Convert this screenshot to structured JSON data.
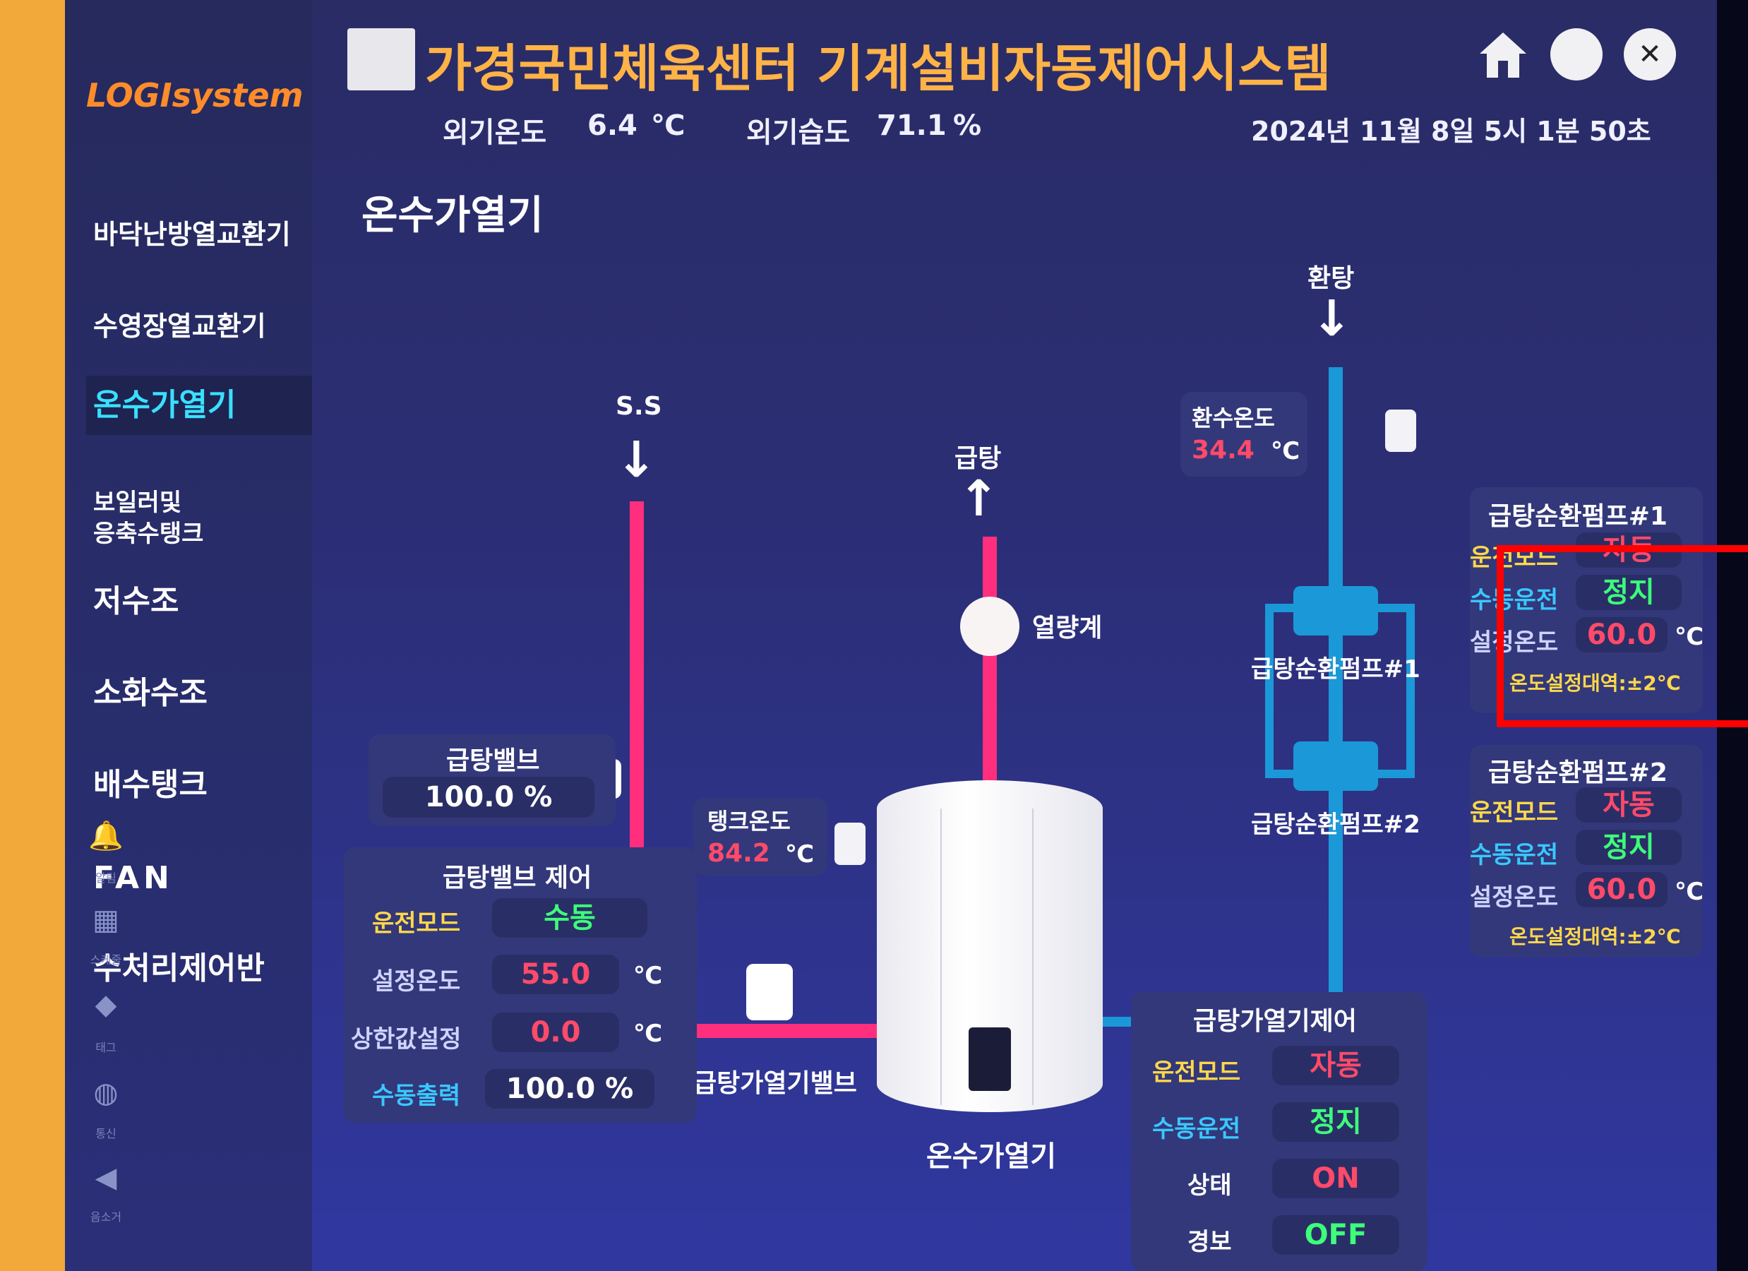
{
  "header": {
    "title": "가경국민체육센터 기계설비자동제어시스템",
    "outdoor_temp_label": "외기온도",
    "outdoor_temp_value": "6.4",
    "outdoor_temp_unit": "℃",
    "outdoor_humidity_label": "외기습도",
    "outdoor_humidity_value": "71.1",
    "outdoor_humidity_unit": "%",
    "datetime": "2024년 11월 8일 5시 1분 50초"
  },
  "sidebar": {
    "logo": "LOGIsystem",
    "items": [
      {
        "label": "바닥난방열교환기"
      },
      {
        "label": "수영장열교환기"
      },
      {
        "label": "온수가열기"
      },
      {
        "label": "보일러및\n응축수탱크"
      },
      {
        "label": "저수조"
      },
      {
        "label": "소화수조"
      },
      {
        "label": "배수탱크"
      },
      {
        "label": "FAN"
      },
      {
        "label": "수처리제어반"
      }
    ],
    "icons": [
      {
        "name": "bell-icon",
        "label": "알림"
      },
      {
        "name": "schedule-icon",
        "label": "스케줄"
      },
      {
        "name": "tag-icon",
        "label": "태그"
      },
      {
        "name": "globe-icon",
        "label": "통신"
      },
      {
        "name": "speaker-icon",
        "label": "음소거"
      }
    ]
  },
  "section_title": "온수가열기",
  "labels": {
    "ss": "S.S",
    "supply": "급탕",
    "return": "환탕",
    "flowmeter": "열량계",
    "return_temp_label": "환수온도",
    "return_temp_value": "34.4",
    "return_temp_unit": "℃",
    "tank_temp_label": "탱크온도",
    "tank_temp_value": "84.2",
    "tank_temp_unit": "℃",
    "heater_valve": "급탕가열기밸브",
    "heater": "온수가열기",
    "pump1": "급탕순환펌프#1",
    "pump2": "급탕순환펌프#2"
  },
  "valve_readout": {
    "title": "급탕밸브",
    "value": "100.0",
    "unit": "%"
  },
  "valve_control": {
    "title": "급탕밸브 제어",
    "mode_label": "운전모드",
    "mode_value": "수동",
    "setpoint_label": "설정온도",
    "setpoint_value": "55.0",
    "setpoint_unit": "℃",
    "upper_label": "상한값설정",
    "upper_value": "0.0",
    "upper_unit": "℃",
    "manual_label": "수동출력",
    "manual_value": "100.0 %"
  },
  "pump1": {
    "title": "급탕순환펌프#1",
    "mode_label": "운전모드",
    "mode_value": "자동",
    "manual_label": "수동운전",
    "manual_value": "정지",
    "setpoint_label": "설정온도",
    "setpoint_value": "60.0",
    "setpoint_unit": "℃",
    "band": "온도설정대역:±2℃"
  },
  "pump2": {
    "title": "급탕순환펌프#2",
    "mode_label": "운전모드",
    "mode_value": "자동",
    "manual_label": "수동운전",
    "manual_value": "정지",
    "setpoint_label": "설정온도",
    "setpoint_value": "60.0",
    "setpoint_unit": "℃",
    "band": "온도설정대역:±2℃"
  },
  "heater_control": {
    "title": "급탕가열기제어",
    "mode_label": "운전모드",
    "mode_value": "자동",
    "manual_label": "수동운전",
    "manual_value": "정지",
    "state_label": "상태",
    "state_value": "ON",
    "alarm_label": "경보",
    "alarm_value": "OFF"
  },
  "colors": {
    "pink_pipe": "#ff2f7d",
    "blue_pipe": "#1b98d8",
    "title": "#ffb347",
    "active_nav": "#39e0ff",
    "value_red": "#ff4a6a",
    "value_green": "#3dff7a",
    "highlight_box": "#ff0000"
  }
}
